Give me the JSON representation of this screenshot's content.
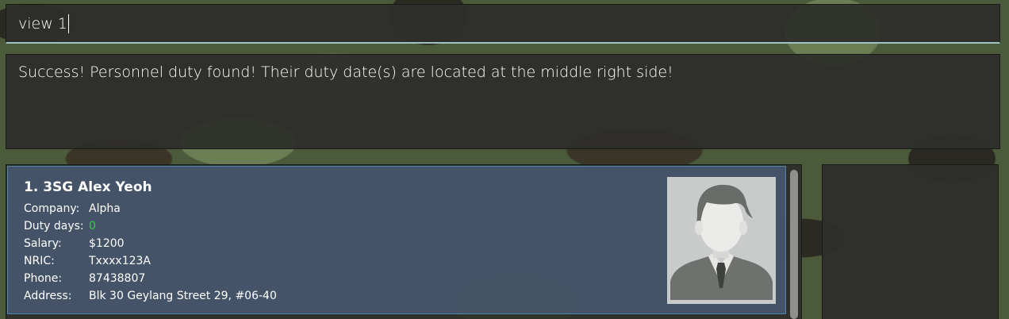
{
  "command": {
    "value": "view 1"
  },
  "result": {
    "message": "Success! Personnel duty found! Their duty date(s) are located at the middle right side!"
  },
  "person": {
    "index_title": "1. 3SG Alex Yeoh",
    "fields": [
      {
        "label": "Company:",
        "value": "Alpha"
      },
      {
        "label": "Duty days:",
        "value": "0"
      },
      {
        "label": "Salary:",
        "value": "$1200"
      },
      {
        "label": "NRIC:",
        "value": "Txxxx123A"
      },
      {
        "label": "Phone:",
        "value": "87438807"
      },
      {
        "label": "Address:",
        "value": "Blk 30 Geylang Street 29, #06-40"
      }
    ],
    "avatar_icon": "person-silhouette-icon"
  },
  "colors": {
    "duty_count": "#3cc84a",
    "card_border": "#4a88a8",
    "command_underline": "#9fc3c4"
  }
}
